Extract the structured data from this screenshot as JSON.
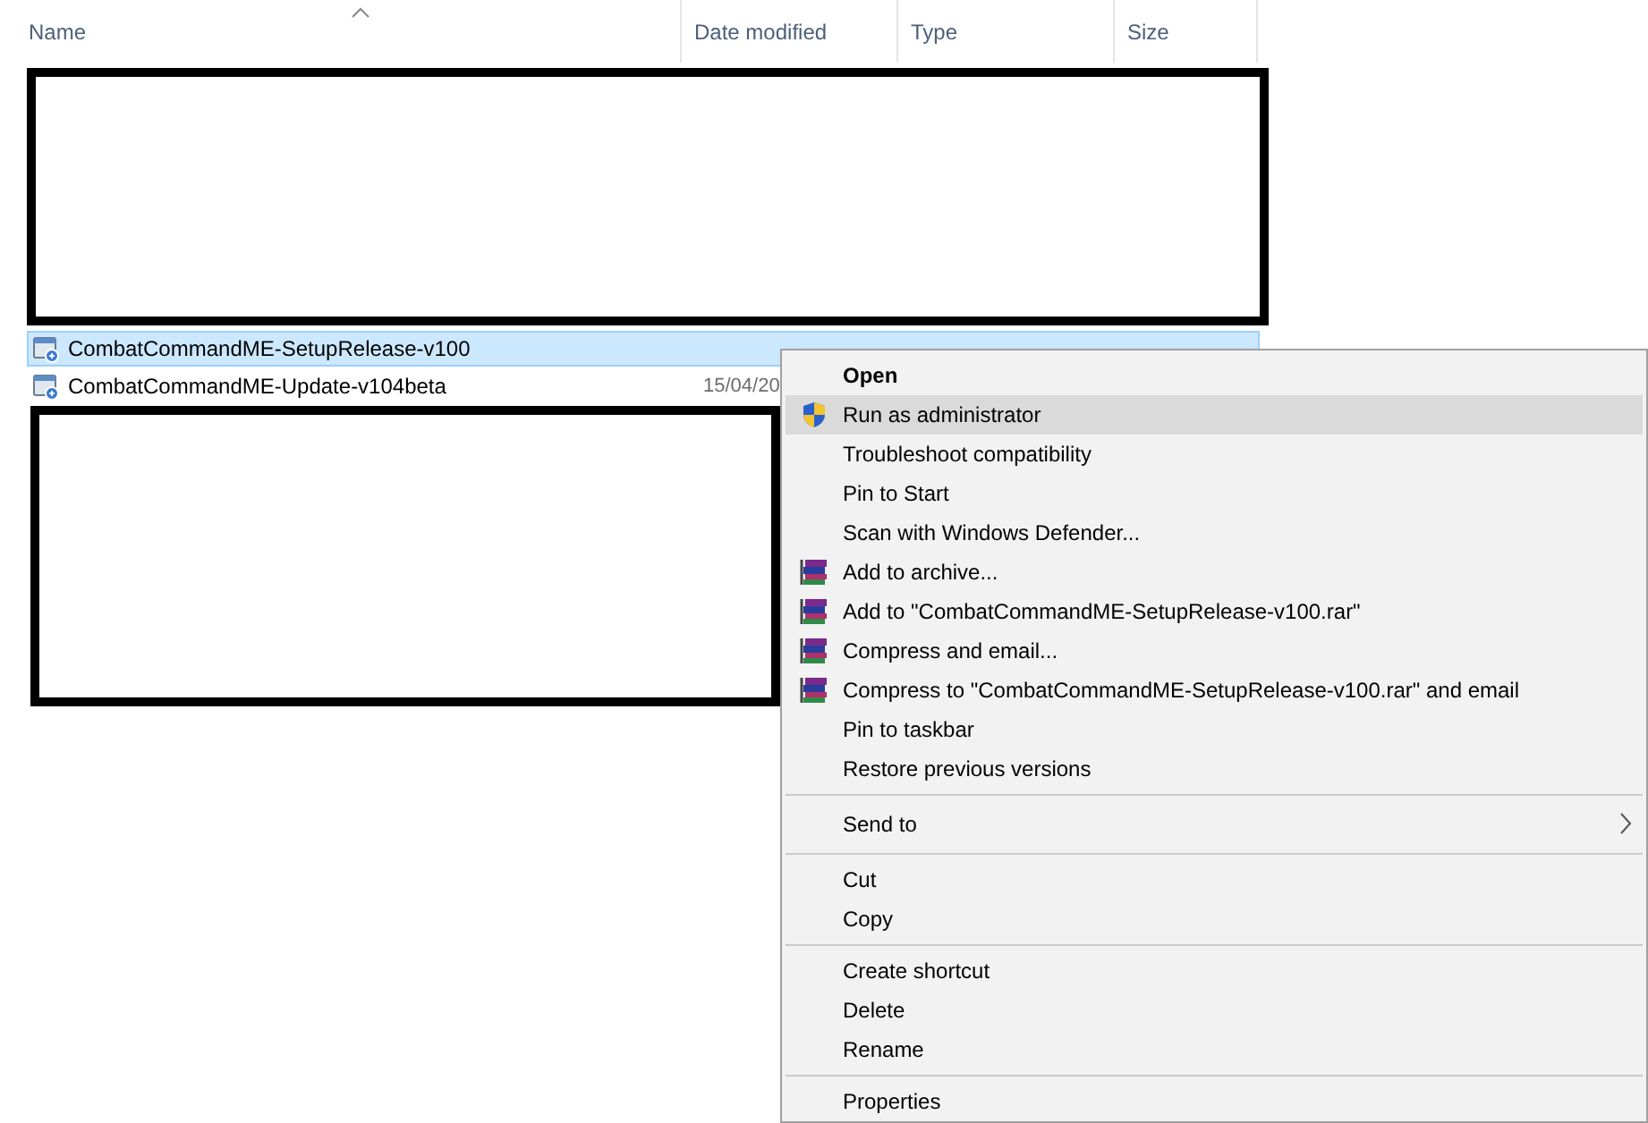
{
  "columns": [
    {
      "label": "Name",
      "sorted": true
    },
    {
      "label": "Date modified",
      "sorted": false
    },
    {
      "label": "Type",
      "sorted": false
    },
    {
      "label": "Size",
      "sorted": false
    }
  ],
  "files": [
    {
      "name": "CombatCommandME-SetupRelease-v100",
      "selected": true
    },
    {
      "name": "CombatCommandME-Update-v104beta",
      "date": "15/04/20",
      "selected": false
    }
  ],
  "context_menu": [
    {
      "kind": "item",
      "label": "Open",
      "bold": true,
      "highlighted": false
    },
    {
      "kind": "shield_item",
      "label": "Run as administrator",
      "bold": false,
      "highlighted": true
    },
    {
      "kind": "item",
      "label": "Troubleshoot compatibility",
      "bold": false,
      "highlighted": false
    },
    {
      "kind": "item",
      "label": "Pin to Start",
      "bold": false,
      "highlighted": false
    },
    {
      "kind": "item",
      "label": "Scan with Windows Defender...",
      "bold": false,
      "highlighted": false
    },
    {
      "kind": "archive_item",
      "label": "Add to archive...",
      "bold": false,
      "highlighted": false
    },
    {
      "kind": "archive_item",
      "label": "Add to \"CombatCommandME-SetupRelease-v100.rar\"",
      "bold": false,
      "highlighted": false
    },
    {
      "kind": "archive_item",
      "label": "Compress and email...",
      "bold": false,
      "highlighted": false
    },
    {
      "kind": "archive_item",
      "label": "Compress to \"CombatCommandME-SetupRelease-v100.rar\" and email",
      "bold": false,
      "highlighted": false
    },
    {
      "kind": "item",
      "label": "Pin to taskbar",
      "bold": false,
      "highlighted": false
    },
    {
      "kind": "item",
      "label": "Restore previous versions",
      "bold": false,
      "highlighted": false
    },
    {
      "kind": "separator"
    },
    {
      "kind": "submenu",
      "label": "Send to",
      "bold": false,
      "highlighted": false
    },
    {
      "kind": "separator"
    },
    {
      "kind": "item",
      "label": "Cut",
      "bold": false,
      "highlighted": false
    },
    {
      "kind": "item",
      "label": "Copy",
      "bold": false,
      "highlighted": false
    },
    {
      "kind": "separator"
    },
    {
      "kind": "item",
      "label": "Create shortcut",
      "bold": false,
      "highlighted": false
    },
    {
      "kind": "item",
      "label": "Delete",
      "bold": false,
      "highlighted": false
    },
    {
      "kind": "item",
      "label": "Rename",
      "bold": false,
      "highlighted": false
    },
    {
      "kind": "separator"
    },
    {
      "kind": "item",
      "label": "Properties",
      "bold": false,
      "highlighted": false
    }
  ]
}
